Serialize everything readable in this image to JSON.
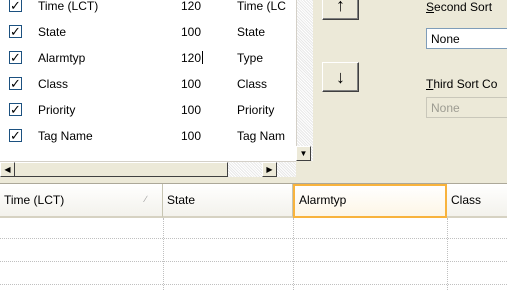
{
  "columns_config": {
    "rows": [
      {
        "checked": true,
        "name": "Time (LCT)",
        "width": "120",
        "label": "Time (LC"
      },
      {
        "checked": true,
        "name": "State",
        "width": "100",
        "label": "State"
      },
      {
        "checked": true,
        "name": "Alarmtyp",
        "width": "120",
        "label": "Type"
      },
      {
        "checked": true,
        "name": "Class",
        "width": "100",
        "label": "Class"
      },
      {
        "checked": true,
        "name": "Priority",
        "width": "100",
        "label": "Priority"
      },
      {
        "checked": true,
        "name": "Tag Name",
        "width": "100",
        "label": "Tag Nam"
      }
    ],
    "check_glyph": "✓"
  },
  "controls": {
    "move_up_glyph": "↑",
    "move_down_glyph": "↓",
    "second_sort_label_key": "S",
    "second_sort_label_rest": "econd Sort",
    "second_sort_value": "None",
    "third_sort_label_key": "T",
    "third_sort_label_rest": "hird Sort Co",
    "third_sort_value": "None"
  },
  "preview_grid": {
    "headers": [
      "Time (LCT)",
      "State",
      "Alarmtyp",
      "Class"
    ],
    "sort_indicator": "∕",
    "rows": [
      [
        "",
        "",
        "",
        ""
      ],
      [
        "",
        "",
        "",
        ""
      ],
      [
        "",
        "",
        "",
        ""
      ]
    ]
  }
}
